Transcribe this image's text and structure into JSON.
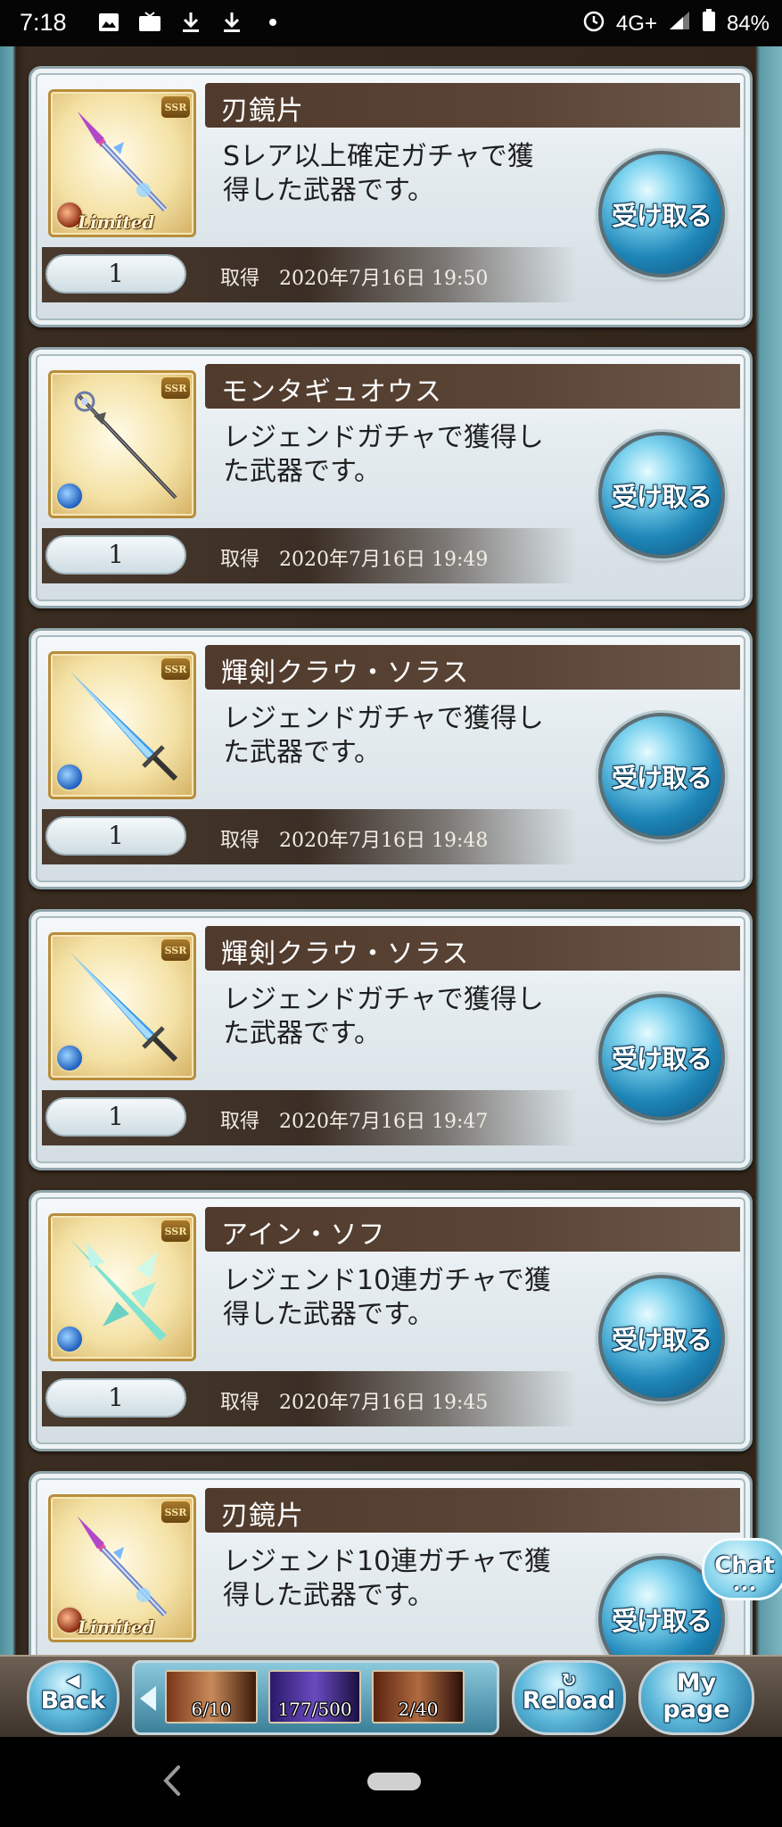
{
  "status_bar": {
    "time": "7:18",
    "network": "4G+",
    "battery": "84%",
    "icons": [
      "image-icon",
      "tv-icon",
      "download-icon",
      "download-icon",
      "dot-icon",
      "alarm-icon",
      "signal-icon",
      "battery-icon"
    ]
  },
  "colors": {
    "receive_button": "#1e86b8",
    "name_bar": "#4f3a2c",
    "panel_frame": "#8fa4ab"
  },
  "items": [
    {
      "name": "刃鏡片",
      "description_line1": "Sレア以上確定ガチャで獲",
      "description_line2": "得した武器です。",
      "quantity": "1",
      "acquired_label": "取得",
      "acquired_datetime": "2020年7月16日 19:50",
      "rarity": "SSR",
      "element": "fire",
      "badge": "Limited",
      "weapon_icon": "spear-icon",
      "receive_label": "受け取る"
    },
    {
      "name": "モンタギュオウス",
      "description_line1": "レジェンドガチャで獲得し",
      "description_line2": "た武器です。",
      "quantity": "1",
      "acquired_label": "取得",
      "acquired_datetime": "2020年7月16日 19:49",
      "rarity": "SSR",
      "element": "water",
      "badge": "",
      "weapon_icon": "staff-icon",
      "receive_label": "受け取る"
    },
    {
      "name": "輝剣クラウ・ソラス",
      "description_line1": "レジェンドガチャで獲得し",
      "description_line2": "た武器です。",
      "quantity": "1",
      "acquired_label": "取得",
      "acquired_datetime": "2020年7月16日 19:48",
      "rarity": "SSR",
      "element": "water",
      "badge": "",
      "weapon_icon": "sword-icon",
      "receive_label": "受け取る"
    },
    {
      "name": "輝剣クラウ・ソラス",
      "description_line1": "レジェンドガチャで獲得し",
      "description_line2": "た武器です。",
      "quantity": "1",
      "acquired_label": "取得",
      "acquired_datetime": "2020年7月16日 19:47",
      "rarity": "SSR",
      "element": "water",
      "badge": "",
      "weapon_icon": "sword-icon",
      "receive_label": "受け取る"
    },
    {
      "name": "アイン・ソフ",
      "description_line1": "レジェンド10連ガチャで獲",
      "description_line2": "得した武器です。",
      "quantity": "1",
      "acquired_label": "取得",
      "acquired_datetime": "2020年7月16日 19:45",
      "rarity": "SSR",
      "element": "water",
      "badge": "",
      "weapon_icon": "crystal-sword-icon",
      "receive_label": "受け取る"
    },
    {
      "name": "刃鏡片",
      "description_line1": "レジェンド10連ガチャで獲",
      "description_line2": "得した武器です。",
      "quantity": "",
      "acquired_label": "",
      "acquired_datetime": "",
      "rarity": "SSR",
      "element": "fire",
      "badge": "Limited",
      "weapon_icon": "spear-icon",
      "receive_label": "受け取る"
    }
  ],
  "chat": {
    "label": "Chat",
    "dots": "•••"
  },
  "toolbar": {
    "back_label": "Back",
    "reload_label": "Reload",
    "mypage_line1": "My",
    "mypage_line2": "page",
    "gauges": [
      {
        "value": "6/10",
        "fill": 0.6
      },
      {
        "value": "177/500",
        "fill": 0.354
      },
      {
        "value": "2/40",
        "fill": 0.05
      }
    ]
  }
}
